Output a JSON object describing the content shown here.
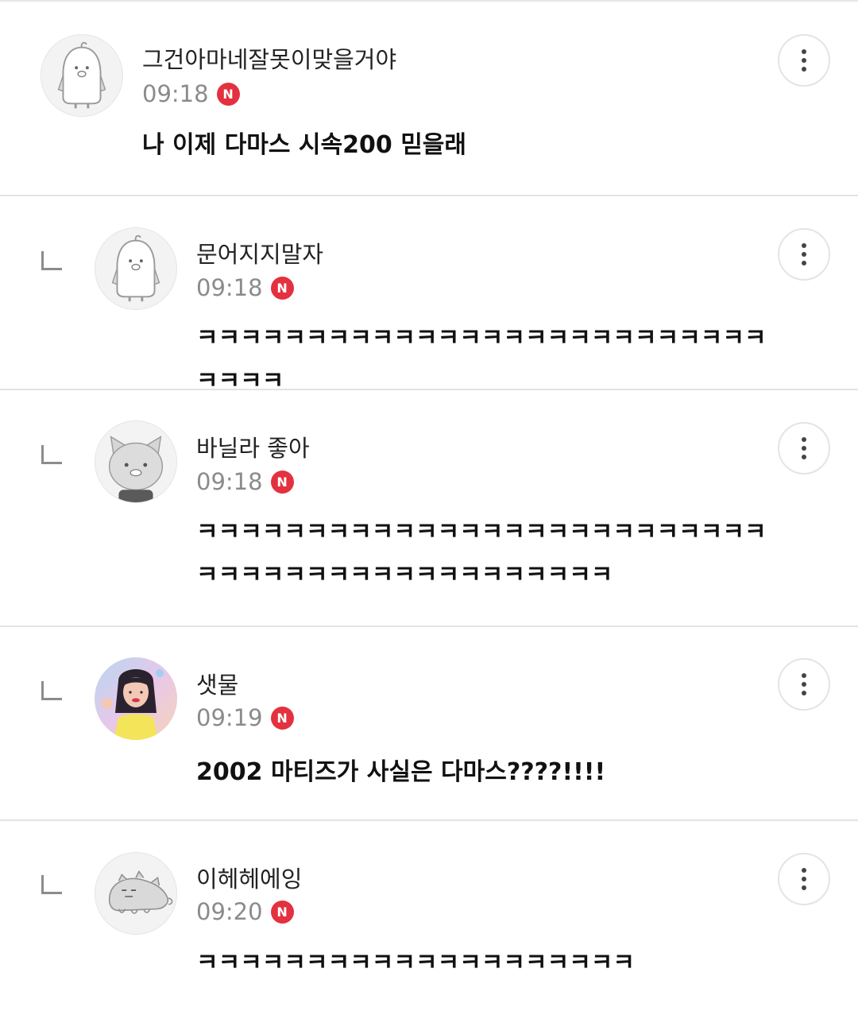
{
  "comments": [
    {
      "nickname": "그건아마네잘못이맞을거야",
      "time": "09:18",
      "badge": "N",
      "text": "나 이제 다마스 시속200 믿을래",
      "avatar_icon": "penguin-avatar-icon",
      "is_reply": false
    },
    {
      "nickname": "문어지지말자",
      "time": "09:18",
      "badge": "N",
      "text": "ㅋㅋㅋㅋㅋㅋㅋㅋㅋㅋㅋㅋㅋㅋㅋㅋㅋㅋㅋㅋㅋㅋㅋㅋㅋㅋㅋㅋㅋㅋ",
      "avatar_icon": "penguin-avatar-icon",
      "is_reply": true
    },
    {
      "nickname": "바닐라 좋아",
      "time": "09:18",
      "badge": "N",
      "text": "ㅋㅋㅋㅋㅋㅋㅋㅋㅋㅋㅋㅋㅋㅋㅋㅋㅋㅋㅋㅋㅋㅋㅋㅋㅋㅋㅋㅋㅋㅋㅋㅋㅋㅋㅋㅋㅋㅋㅋㅋㅋㅋㅋㅋㅋ",
      "avatar_icon": "cat-avatar-icon",
      "is_reply": true
    },
    {
      "nickname": "샛물",
      "time": "09:19",
      "badge": "N",
      "text": "2002 마티즈가 사실은 다마스????!!!!",
      "avatar_icon": "photo-avatar-icon",
      "is_reply": true
    },
    {
      "nickname": "이헤헤에잉",
      "time": "09:20",
      "badge": "N",
      "text": "ㅋㅋㅋㅋㅋㅋㅋㅋㅋㅋㅋㅋㅋㅋㅋㅋㅋㅋㅋㅋ",
      "avatar_icon": "blob-creature-avatar-icon",
      "is_reply": true
    }
  ],
  "colors": {
    "badge": "#e3313f",
    "time": "#8b8b8b",
    "divider": "#e3e3e3"
  },
  "icons": {
    "more": "more-vertical-icon",
    "reply": "reply-indent-icon"
  }
}
